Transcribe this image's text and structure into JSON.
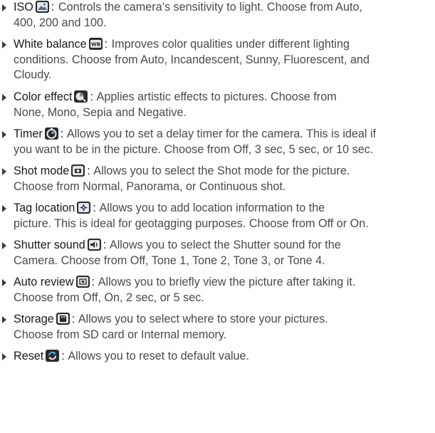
{
  "items": [
    {
      "title": "ISO",
      "icon": "iso-icon",
      "desc": "Controls the camera’s sensitivity to light. Choose from Auto,",
      "cont": "400, 200 and 100."
    },
    {
      "title": "White balance",
      "icon": "white-balance-icon",
      "desc": "Improves color qualities under different lighting",
      "cont": "conditions. Choose from Auto, Incandescent, Sunny, Fluorescent, and",
      "cont2": "Cloudy."
    },
    {
      "title": "Color effect",
      "icon": "color-effect-icon",
      "desc": "Applies artistic effects to pictures. Choose from",
      "cont": "None, Mono, Sepia and Negative."
    },
    {
      "title": "Timer",
      "icon": "timer-icon",
      "desc": "Allows you to set a delay timer for the camera. This is ideal if",
      "cont": "you want to be in the picture. Choose from Off, 3 sec, 5 sec, or 10 sec."
    },
    {
      "title": "Shot mode",
      "icon": "shot-mode-icon",
      "desc": "Allows you to select the Shot mode for the picture.",
      "cont": "Choose from Normal, Panorama, or Continuous shot."
    },
    {
      "title": "Tag location",
      "icon": "tag-location-icon",
      "desc": "Allows you to add location information to the",
      "cont": "picture. This is ideal for geotagging purposes. Choose from Off or On."
    },
    {
      "title": "Shutter sound",
      "icon": "shutter-sound-icon",
      "desc": "Allows you to select the Shutter sound for the",
      "cont": "Camera. Choose from Off, Tone 1, Tone 2, Tone 3, or Tone 4."
    },
    {
      "title": "Auto review",
      "icon": "auto-review-icon",
      "desc": "Allows you to briefly view the picture after taking it.",
      "cont": "Choose from Off, On, 2 sec, or 5 sec."
    },
    {
      "title": "Storage",
      "icon": "storage-icon",
      "desc": "Allows you to select where to store your pictures.",
      "cont": "Choose from SD card or Internal memory."
    },
    {
      "title": "Reset",
      "icon": "reset-icon",
      "desc": "Allows you to reset to default value."
    }
  ],
  "colon": ":"
}
